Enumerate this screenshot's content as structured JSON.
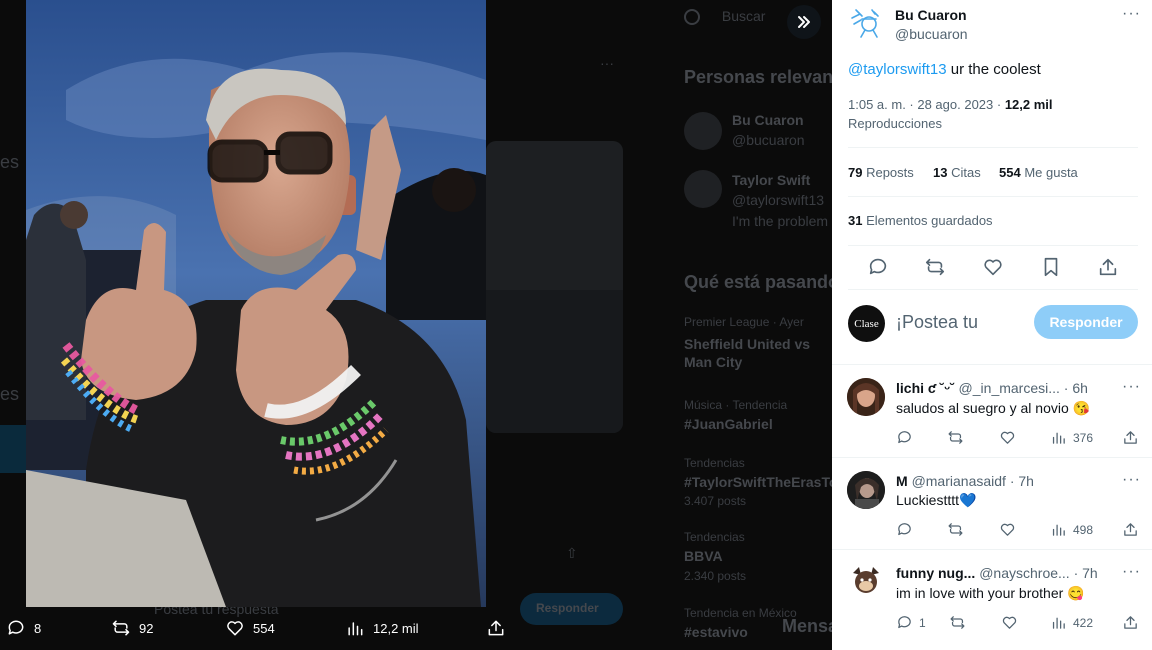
{
  "background_page": {
    "search_placeholder": "Buscar",
    "relevant_title": "Personas relevantes",
    "person1_name": "Bu Cuaron",
    "person1_handle": "@bucuaron",
    "person2_name": "Taylor Swift",
    "person2_handle": "@taylorswift13",
    "person2_bio": "I'm the problem",
    "trending_title": "Qué está pasando",
    "trends": [
      {
        "context": "Premier League · Ayer",
        "name": "Sheffield United vs Man City",
        "posts": ""
      },
      {
        "context": "Música · Tendencia",
        "name": "#JuanGabriel",
        "posts": ""
      },
      {
        "context": "Tendencias",
        "name": "#TaylorSwiftTheErasTour",
        "posts": "3.407 posts"
      },
      {
        "context": "Tendencias",
        "name": "BBVA",
        "posts": "2.340 posts"
      },
      {
        "context": "Tendencia en México",
        "name": "#estavivo",
        "posts": ""
      }
    ],
    "post_placeholder": "Postea tu respuesta",
    "reply_button": "Responder",
    "messages_label": "Mensajes",
    "left_fragment_1": "es",
    "left_fragment_2": "es"
  },
  "media_actions": {
    "replies": "8",
    "reposts": "92",
    "likes": "554",
    "views": "12,2 mil"
  },
  "tweet": {
    "author_name": "Bu Cuaron",
    "author_handle": "@bucuaron",
    "mention": "@taylorswift13",
    "text": " ur the coolest",
    "time": "1:05 a. m. · 28 ago. 2023 · ",
    "views_count": "12,2 mil",
    "views_label": "Reproducciones",
    "reposts_count": "79",
    "reposts_label": " Reposts",
    "quotes_count": "13",
    "quotes_label": " Citas",
    "likes_count": "554",
    "likes_label": " Me gusta",
    "bookmarks_count": "31",
    "bookmarks_label": " Elementos guardados"
  },
  "composer": {
    "avatar_text": "Clase",
    "placeholder": "¡Postea tu",
    "button": "Responder"
  },
  "replies": [
    {
      "name": "lichi ƈ ˘ᵕ˘ ",
      "handle": "@_in_marcesi...",
      "time": "· 6h",
      "text": "saludos al suegro y al novio 😘",
      "reply_count": "",
      "views": "376"
    },
    {
      "name": "M",
      "handle": "@marianasaidf",
      "time": "· 7h",
      "text": "Luckiestttt💙",
      "reply_count": "",
      "views": "498"
    },
    {
      "name": "funny nug...",
      "handle": "@nayschroe...",
      "time": "· 7h",
      "text": "im in love with your brother 😋",
      "reply_count": "1",
      "views": "422"
    }
  ],
  "colors": {
    "accent": "#1d9bf0",
    "button_disabled": "#8ecdf8",
    "text_primary": "#0f1419",
    "text_secondary": "#536471"
  }
}
